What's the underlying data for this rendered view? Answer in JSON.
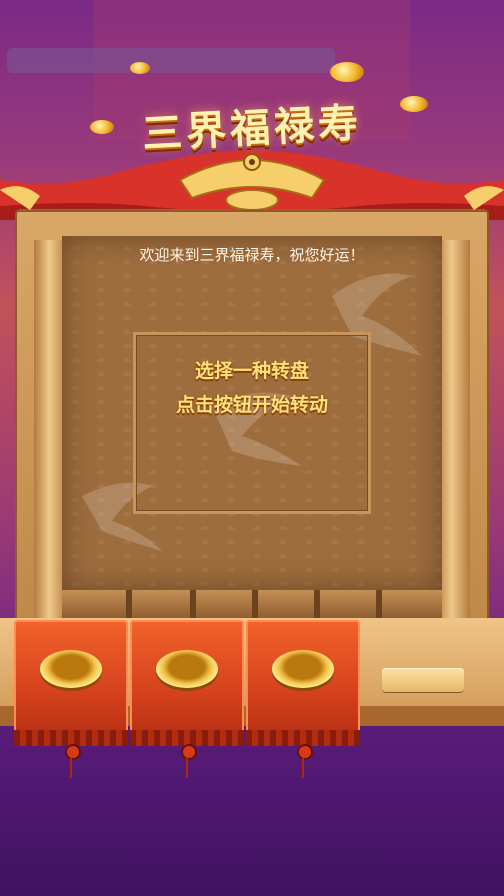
{
  "game": {
    "title": "三界福禄寿",
    "welcome_text": "欢迎来到三界福禄寿，祝您好运！",
    "instruction_line1": "选择一种转盘",
    "instruction_line2": "点击按钮开始转动"
  },
  "wheels": [
    {
      "name": "wheel-1"
    },
    {
      "name": "wheel-2"
    },
    {
      "name": "wheel-3"
    }
  ],
  "colors": {
    "accent_gold": "#ffe27a",
    "cloth_red": "#d3401c",
    "background_purple": "#6a2288"
  }
}
